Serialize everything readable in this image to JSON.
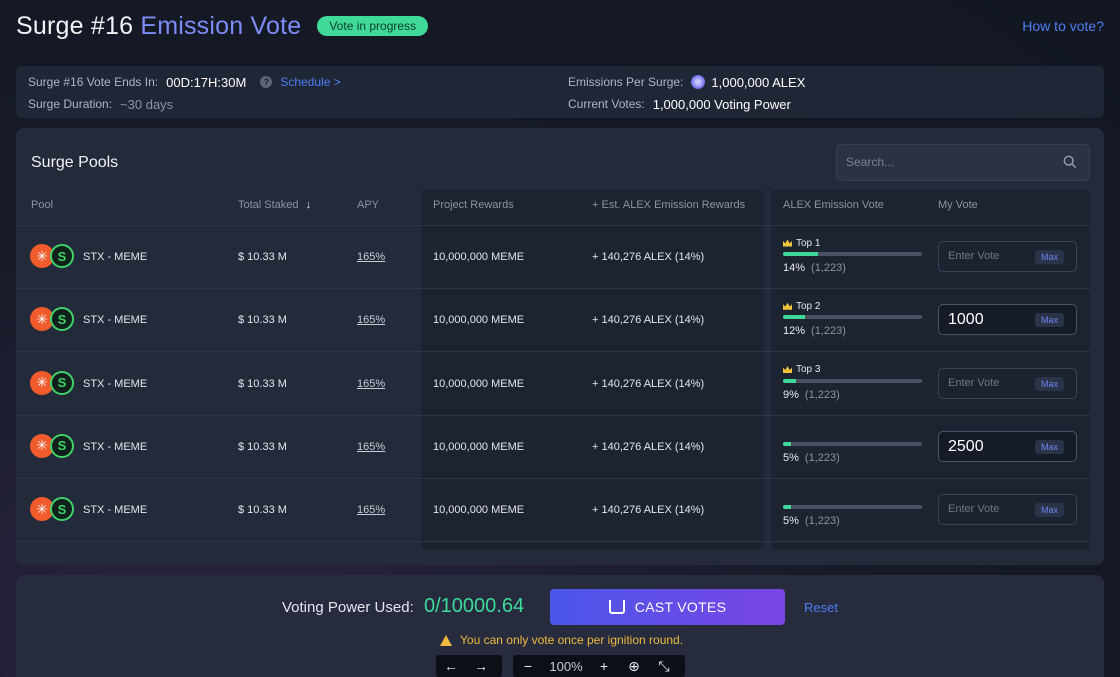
{
  "header": {
    "title_main": "Surge #16",
    "title_accent": "Emission Vote",
    "status_badge": "Vote in progress",
    "how_to_vote": "How to vote?"
  },
  "info": {
    "ends_label": "Surge #16 Vote Ends In:",
    "ends_value": "00D:17H:30M",
    "schedule_link": "Schedule >",
    "duration_label": "Surge Duration:",
    "duration_value": "~30 days",
    "emissions_label": "Emissions Per Surge:",
    "emissions_value": "1,000,000 ALEX",
    "votes_label": "Current Votes:",
    "votes_value": "1,000,000 Voting Power"
  },
  "panel": {
    "title": "Surge Pools",
    "search_placeholder": "Search..."
  },
  "columns": {
    "pool": "Pool",
    "total_staked": "Total Staked",
    "apy": "APY",
    "project_rewards": "Project Rewards",
    "est_rewards": "+ Est. ALEX Emission Rewards",
    "emission_vote": "ALEX Emission Vote",
    "my_vote": "My Vote"
  },
  "rows": [
    {
      "pool": "STX - MEME",
      "staked": "$ 10.33 M",
      "apy": "165%",
      "project_rewards": "10,000,000 MEME",
      "est_rewards": "+ 140,276 ALEX (14%)",
      "rank": "Top 1",
      "vote_pct": "14%",
      "vote_count": "(1,223)",
      "fill": 0.25,
      "my_vote": "",
      "placeholder": "Enter Vote",
      "max": "Max"
    },
    {
      "pool": "STX - MEME",
      "staked": "$ 10.33 M",
      "apy": "165%",
      "project_rewards": "10,000,000 MEME",
      "est_rewards": "+ 140,276 ALEX (14%)",
      "rank": "Top 2",
      "vote_pct": "12%",
      "vote_count": "(1,223)",
      "fill": 0.16,
      "my_vote": "1000",
      "placeholder": "Enter Vote",
      "max": "Max"
    },
    {
      "pool": "STX - MEME",
      "staked": "$ 10.33 M",
      "apy": "165%",
      "project_rewards": "10,000,000 MEME",
      "est_rewards": "+ 140,276 ALEX (14%)",
      "rank": "Top 3",
      "vote_pct": "9%",
      "vote_count": "(1,223)",
      "fill": 0.09,
      "my_vote": "",
      "placeholder": "Enter Vote",
      "max": "Max"
    },
    {
      "pool": "STX - MEME",
      "staked": "$ 10.33 M",
      "apy": "165%",
      "project_rewards": "10,000,000 MEME",
      "est_rewards": "+ 140,276 ALEX (14%)",
      "rank": "",
      "vote_pct": "5%",
      "vote_count": "(1,223)",
      "fill": 0.06,
      "my_vote": "2500",
      "placeholder": "Enter Vote",
      "max": "Max"
    },
    {
      "pool": "STX - MEME",
      "staked": "$ 10.33 M",
      "apy": "165%",
      "project_rewards": "10,000,000 MEME",
      "est_rewards": "+ 140,276 ALEX (14%)",
      "rank": "",
      "vote_pct": "5%",
      "vote_count": "(1,223)",
      "fill": 0.06,
      "my_vote": "",
      "placeholder": "Enter Vote",
      "max": "Max"
    }
  ],
  "footer": {
    "vp_label": "Voting Power Used:",
    "vp_value": "0/10000.64",
    "cast_button": "CAST VOTES",
    "reset": "Reset",
    "warning": "You can only vote once per ignition round."
  },
  "toolbar": {
    "zoom": "100%"
  },
  "colors": {
    "accent_green": "#3fd99a",
    "accent_blue": "#4f7df5",
    "brand_purple": "#7a45e6"
  }
}
